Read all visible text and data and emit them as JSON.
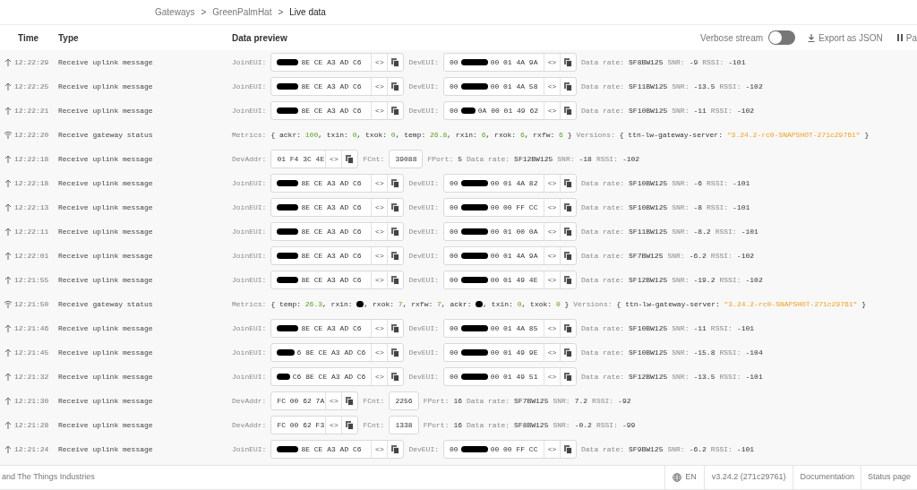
{
  "breadcrumb": [
    {
      "label": "Gateways",
      "current": false
    },
    {
      "label": "GreenPalmHat",
      "current": false
    },
    {
      "label": "Live data",
      "current": true
    }
  ],
  "breadcrumb_separators": [
    ">",
    ">"
  ],
  "columns": [
    "Time",
    "Type",
    "Data preview"
  ],
  "toolbar": {
    "verbose_label": "Verbose stream",
    "verbose_on": false,
    "export_label": "Export as JSON",
    "pause_label": "Pa"
  },
  "rows": [
    {
      "kind": "uplink",
      "time": "12:22:29",
      "type": "Receive uplink message",
      "parts": [
        {
          "kind": "label",
          "text": "JoinEUI:"
        },
        {
          "kind": "box",
          "segments": [
            {
              "redacted": true
            },
            {
              "text": "8E CE A3 AD C6"
            }
          ],
          "code": "<>"
        },
        {
          "kind": "label",
          "text": "DevEUI:"
        },
        {
          "kind": "box",
          "segments": [
            {
              "text": "00"
            },
            {
              "redacted": true
            },
            {
              "text": "00 01 4A 9A"
            }
          ],
          "code": "<>"
        },
        {
          "kind": "label",
          "text": "Data rate:"
        },
        {
          "kind": "value",
          "text": "SF8BW125"
        },
        {
          "kind": "label",
          "text": "SNR:"
        },
        {
          "kind": "value",
          "text": "-9"
        },
        {
          "kind": "label",
          "text": "RSSI:"
        },
        {
          "kind": "value",
          "text": "-101"
        }
      ]
    },
    {
      "kind": "uplink",
      "time": "12:22:25",
      "type": "Receive uplink message",
      "parts": [
        {
          "kind": "label",
          "text": "JoinEUI:"
        },
        {
          "kind": "box",
          "segments": [
            {
              "redacted": true
            },
            {
              "text": "8E CE A3 AD C6"
            }
          ],
          "code": "<>"
        },
        {
          "kind": "label",
          "text": "DevEUI:"
        },
        {
          "kind": "box",
          "segments": [
            {
              "text": "00"
            },
            {
              "redacted": true
            },
            {
              "text": "00 01 4A 58"
            }
          ],
          "code": "<>"
        },
        {
          "kind": "label",
          "text": "Data rate:"
        },
        {
          "kind": "value",
          "text": "SF11BW125"
        },
        {
          "kind": "label",
          "text": "SNR:"
        },
        {
          "kind": "value",
          "text": "-13.5"
        },
        {
          "kind": "label",
          "text": "RSSI:"
        },
        {
          "kind": "value",
          "text": "-102"
        }
      ]
    },
    {
      "kind": "uplink",
      "time": "12:22:21",
      "type": "Receive uplink message",
      "parts": [
        {
          "kind": "label",
          "text": "JoinEUI:"
        },
        {
          "kind": "box",
          "segments": [
            {
              "redacted": true
            },
            {
              "text": "8E CE A3 AD C6"
            }
          ],
          "code": "<>"
        },
        {
          "kind": "label",
          "text": "DevEUI:"
        },
        {
          "kind": "box",
          "segments": [
            {
              "text": "00"
            },
            {
              "redacted": true
            },
            {
              "text": "0A 00 01 49 62"
            }
          ],
          "code": "<>"
        },
        {
          "kind": "label",
          "text": "Data rate:"
        },
        {
          "kind": "value",
          "text": "SF10BW125"
        },
        {
          "kind": "label",
          "text": "SNR:"
        },
        {
          "kind": "value",
          "text": "-11"
        },
        {
          "kind": "label",
          "text": "RSSI:"
        },
        {
          "kind": "value",
          "text": "-102"
        }
      ]
    },
    {
      "kind": "gateway",
      "time": "12:22:20",
      "type": "Receive gateway status",
      "parts": [
        {
          "kind": "label",
          "text": "Metrics:"
        },
        {
          "kind": "code",
          "tokens": [
            {
              "text": "{ ackr: "
            },
            {
              "text": "100",
              "kind": "number"
            },
            {
              "text": ", txin: "
            },
            {
              "text": "0",
              "kind": "number"
            },
            {
              "text": ", txok: "
            },
            {
              "text": "0",
              "kind": "number"
            },
            {
              "text": ", temp: "
            },
            {
              "text": "26.8",
              "kind": "number"
            },
            {
              "text": ", rxin: "
            },
            {
              "text": "6",
              "kind": "number"
            },
            {
              "text": ", rxok: "
            },
            {
              "text": "6",
              "kind": "number"
            },
            {
              "text": ", rxfw: "
            },
            {
              "text": "6",
              "kind": "number"
            },
            {
              "text": " }"
            }
          ]
        },
        {
          "kind": "label",
          "text": "Versions:"
        },
        {
          "kind": "code",
          "tokens": [
            {
              "text": "{ ttn-lw-gateway-server: "
            },
            {
              "text": "\"3.24.2-rc0-SNAPSHOT-271c29761\"",
              "kind": "string"
            },
            {
              "text": " }"
            }
          ]
        }
      ]
    },
    {
      "kind": "uplink",
      "time": "12:22:18",
      "type": "Receive uplink message",
      "parts": [
        {
          "kind": "label",
          "text": "DevAddr:"
        },
        {
          "kind": "box",
          "segments": [
            {
              "text": "01 F4 3C 4E"
            }
          ],
          "code": "<>"
        },
        {
          "kind": "label",
          "text": "FCnt:"
        },
        {
          "kind": "plain_box",
          "text": "39088"
        },
        {
          "kind": "label",
          "text": "FPort:"
        },
        {
          "kind": "value",
          "text": "5"
        },
        {
          "kind": "label",
          "text": "Data rate:"
        },
        {
          "kind": "value",
          "text": "SF12BW125"
        },
        {
          "kind": "label",
          "text": "SNR:"
        },
        {
          "kind": "value",
          "text": "-18"
        },
        {
          "kind": "label",
          "text": "RSSI:"
        },
        {
          "kind": "value",
          "text": "-102"
        }
      ]
    },
    {
      "kind": "uplink",
      "time": "12:22:18",
      "type": "Receive uplink message",
      "parts": [
        {
          "kind": "label",
          "text": "JoinEUI:"
        },
        {
          "kind": "box",
          "segments": [
            {
              "redacted": true
            },
            {
              "text": "8E CE A3 AD C6"
            }
          ],
          "code": "<>"
        },
        {
          "kind": "label",
          "text": "DevEUI:"
        },
        {
          "kind": "box",
          "segments": [
            {
              "text": "00"
            },
            {
              "redacted": true
            },
            {
              "text": "00 01 4A 82"
            }
          ],
          "code": "<>"
        },
        {
          "kind": "label",
          "text": "Data rate:"
        },
        {
          "kind": "value",
          "text": "SF10BW125"
        },
        {
          "kind": "label",
          "text": "SNR:"
        },
        {
          "kind": "value",
          "text": "-6"
        },
        {
          "kind": "label",
          "text": "RSSI:"
        },
        {
          "kind": "value",
          "text": "-101"
        }
      ]
    },
    {
      "kind": "uplink",
      "time": "12:22:13",
      "type": "Receive uplink message",
      "parts": [
        {
          "kind": "label",
          "text": "JoinEUI:"
        },
        {
          "kind": "box",
          "segments": [
            {
              "redacted": true
            },
            {
              "text": "8E CE A3 AD C6"
            }
          ],
          "code": "<>"
        },
        {
          "kind": "label",
          "text": "DevEUI:"
        },
        {
          "kind": "box",
          "segments": [
            {
              "text": "00"
            },
            {
              "redacted": true
            },
            {
              "text": "00 00 FF CC"
            }
          ],
          "code": "<>"
        },
        {
          "kind": "label",
          "text": "Data rate:"
        },
        {
          "kind": "value",
          "text": "SF10BW125"
        },
        {
          "kind": "label",
          "text": "SNR:"
        },
        {
          "kind": "value",
          "text": "-8"
        },
        {
          "kind": "label",
          "text": "RSSI:"
        },
        {
          "kind": "value",
          "text": "-101"
        }
      ]
    },
    {
      "kind": "uplink",
      "time": "12:22:11",
      "type": "Receive uplink message",
      "parts": [
        {
          "kind": "label",
          "text": "JoinEUI:"
        },
        {
          "kind": "box",
          "segments": [
            {
              "redacted": true
            },
            {
              "text": "8E CE A3 AD C6"
            }
          ],
          "code": "<>"
        },
        {
          "kind": "label",
          "text": "DevEUI:"
        },
        {
          "kind": "box",
          "segments": [
            {
              "text": "00"
            },
            {
              "redacted": true
            },
            {
              "text": "00 01 00 0A"
            }
          ],
          "code": "<>"
        },
        {
          "kind": "label",
          "text": "Data rate:"
        },
        {
          "kind": "value",
          "text": "SF11BW125"
        },
        {
          "kind": "label",
          "text": "SNR:"
        },
        {
          "kind": "value",
          "text": "-8.2"
        },
        {
          "kind": "label",
          "text": "RSSI:"
        },
        {
          "kind": "value",
          "text": "-101"
        }
      ]
    },
    {
      "kind": "uplink",
      "time": "12:22:01",
      "type": "Receive uplink message",
      "parts": [
        {
          "kind": "label",
          "text": "JoinEUI:"
        },
        {
          "kind": "box",
          "segments": [
            {
              "redacted": true
            },
            {
              "text": "8E CE A3 AD C6"
            }
          ],
          "code": "<>"
        },
        {
          "kind": "label",
          "text": "DevEUI:"
        },
        {
          "kind": "box",
          "segments": [
            {
              "text": "00"
            },
            {
              "redacted": true
            },
            {
              "text": "00 01 4A 9A"
            }
          ],
          "code": "<>"
        },
        {
          "kind": "label",
          "text": "Data rate:"
        },
        {
          "kind": "value",
          "text": "SF7BW125"
        },
        {
          "kind": "label",
          "text": "SNR:"
        },
        {
          "kind": "value",
          "text": "-6.2"
        },
        {
          "kind": "label",
          "text": "RSSI:"
        },
        {
          "kind": "value",
          "text": "-102"
        }
      ]
    },
    {
      "kind": "uplink",
      "time": "12:21:55",
      "type": "Receive uplink message",
      "parts": [
        {
          "kind": "label",
          "text": "JoinEUI:"
        },
        {
          "kind": "box",
          "segments": [
            {
              "redacted": true
            },
            {
              "text": "8E CE A3 AD C6"
            }
          ],
          "code": "<>"
        },
        {
          "kind": "label",
          "text": "DevEUI:"
        },
        {
          "kind": "box",
          "segments": [
            {
              "text": "00"
            },
            {
              "redacted": true
            },
            {
              "text": "00 01 49 4E"
            }
          ],
          "code": "<>"
        },
        {
          "kind": "label",
          "text": "Data rate:"
        },
        {
          "kind": "value",
          "text": "SF12BW125"
        },
        {
          "kind": "label",
          "text": "SNR:"
        },
        {
          "kind": "value",
          "text": "-19.2"
        },
        {
          "kind": "label",
          "text": "RSSI:"
        },
        {
          "kind": "value",
          "text": "-102"
        }
      ]
    },
    {
      "kind": "gateway",
      "time": "12:21:50",
      "type": "Receive gateway status",
      "parts": [
        {
          "kind": "label",
          "text": "Metrics:"
        },
        {
          "kind": "code",
          "tokens": [
            {
              "text": "{ temp: "
            },
            {
              "text": "26.3",
              "kind": "number"
            },
            {
              "text": ", rxin: "
            },
            {
              "kind": "redacted"
            },
            {
              "text": ", rxok: "
            },
            {
              "text": "7",
              "kind": "number"
            },
            {
              "text": ", rxfw: "
            },
            {
              "text": "7",
              "kind": "number"
            },
            {
              "text": ", ackr: "
            },
            {
              "kind": "redacted"
            },
            {
              "text": ", txin: "
            },
            {
              "text": "0",
              "kind": "number"
            },
            {
              "text": ", txok: "
            },
            {
              "text": "0",
              "kind": "number"
            },
            {
              "text": " }"
            }
          ]
        },
        {
          "kind": "label",
          "text": "Versions:"
        },
        {
          "kind": "code",
          "tokens": [
            {
              "text": "{ ttn-lw-gateway-server: "
            },
            {
              "text": "\"3.24.2-rc0-SNAPSHOT-271c29761\"",
              "kind": "string"
            },
            {
              "text": " }"
            }
          ]
        }
      ]
    },
    {
      "kind": "uplink",
      "time": "12:21:46",
      "type": "Receive uplink message",
      "parts": [
        {
          "kind": "label",
          "text": "JoinEUI:"
        },
        {
          "kind": "box",
          "segments": [
            {
              "redacted": true
            },
            {
              "text": "8E CE A3 AD C6"
            }
          ],
          "code": "<>"
        },
        {
          "kind": "label",
          "text": "DevEUI:"
        },
        {
          "kind": "box",
          "segments": [
            {
              "text": "00"
            },
            {
              "redacted": true
            },
            {
              "text": "00 01 4A 85"
            }
          ],
          "code": "<>"
        },
        {
          "kind": "label",
          "text": "Data rate:"
        },
        {
          "kind": "value",
          "text": "SF10BW125"
        },
        {
          "kind": "label",
          "text": "SNR:"
        },
        {
          "kind": "value",
          "text": "-11"
        },
        {
          "kind": "label",
          "text": "RSSI:"
        },
        {
          "kind": "value",
          "text": "-101"
        }
      ]
    },
    {
      "kind": "uplink",
      "time": "12:21:45",
      "type": "Receive uplink message",
      "parts": [
        {
          "kind": "label",
          "text": "JoinEUI:"
        },
        {
          "kind": "box",
          "segments": [
            {
              "redacted": true
            },
            {
              "text": "6 8E CE A3 AD C6"
            }
          ],
          "code": "<>"
        },
        {
          "kind": "label",
          "text": "DevEUI:"
        },
        {
          "kind": "box",
          "segments": [
            {
              "text": "00"
            },
            {
              "redacted": true
            },
            {
              "text": "00 01 49 9E"
            }
          ],
          "code": "<>"
        },
        {
          "kind": "label",
          "text": "Data rate:"
        },
        {
          "kind": "value",
          "text": "SF10BW125"
        },
        {
          "kind": "label",
          "text": "SNR:"
        },
        {
          "kind": "value",
          "text": "-15.8"
        },
        {
          "kind": "label",
          "text": "RSSI:"
        },
        {
          "kind": "value",
          "text": "-104"
        }
      ]
    },
    {
      "kind": "uplink",
      "time": "12:21:32",
      "type": "Receive uplink message",
      "parts": [
        {
          "kind": "label",
          "text": "JoinEUI:"
        },
        {
          "kind": "box",
          "segments": [
            {
              "redacted": true
            },
            {
              "text": "C6 8E CE A3 AD C6"
            }
          ],
          "code": "<>"
        },
        {
          "kind": "label",
          "text": "DevEUI:"
        },
        {
          "kind": "box",
          "segments": [
            {
              "text": "00"
            },
            {
              "redacted": true
            },
            {
              "text": "00 01 49 51"
            }
          ],
          "code": "<>"
        },
        {
          "kind": "label",
          "text": "Data rate:"
        },
        {
          "kind": "value",
          "text": "SF12BW125"
        },
        {
          "kind": "label",
          "text": "SNR:"
        },
        {
          "kind": "value",
          "text": "-13.5"
        },
        {
          "kind": "label",
          "text": "RSSI:"
        },
        {
          "kind": "value",
          "text": "-101"
        }
      ]
    },
    {
      "kind": "uplink",
      "time": "12:21:30",
      "type": "Receive uplink message",
      "parts": [
        {
          "kind": "label",
          "text": "DevAddr:"
        },
        {
          "kind": "box",
          "segments": [
            {
              "text": "FC 00 62 7A"
            }
          ],
          "code": "<>"
        },
        {
          "kind": "label",
          "text": "FCnt:"
        },
        {
          "kind": "plain_box",
          "text": "2256"
        },
        {
          "kind": "label",
          "text": "FPort:"
        },
        {
          "kind": "value",
          "text": "16"
        },
        {
          "kind": "label",
          "text": "Data rate:"
        },
        {
          "kind": "value",
          "text": "SF7BW125"
        },
        {
          "kind": "label",
          "text": "SNR:"
        },
        {
          "kind": "value",
          "text": "7.2"
        },
        {
          "kind": "label",
          "text": "RSSI:"
        },
        {
          "kind": "value",
          "text": "-92"
        }
      ]
    },
    {
      "kind": "uplink",
      "time": "12:21:28",
      "type": "Receive uplink message",
      "parts": [
        {
          "kind": "label",
          "text": "DevAddr:"
        },
        {
          "kind": "box",
          "segments": [
            {
              "text": "FC 00 62 F3"
            }
          ],
          "code": "<>"
        },
        {
          "kind": "label",
          "text": "FCnt:"
        },
        {
          "kind": "plain_box",
          "text": "1338"
        },
        {
          "kind": "label",
          "text": "FPort:"
        },
        {
          "kind": "value",
          "text": "16"
        },
        {
          "kind": "label",
          "text": "Data rate:"
        },
        {
          "kind": "value",
          "text": "SF8BW125"
        },
        {
          "kind": "label",
          "text": "SNR:"
        },
        {
          "kind": "value",
          "text": "-0.2"
        },
        {
          "kind": "label",
          "text": "RSSI:"
        },
        {
          "kind": "value",
          "text": "-99"
        }
      ]
    },
    {
      "kind": "uplink",
      "time": "12:21:24",
      "type": "Receive uplink message",
      "parts": [
        {
          "kind": "label",
          "text": "JoinEUI:"
        },
        {
          "kind": "box",
          "segments": [
            {
              "redacted": true
            },
            {
              "text": "8E CE A3 AD C6"
            }
          ],
          "code": "<>"
        },
        {
          "kind": "label",
          "text": "DevEUI:"
        },
        {
          "kind": "box",
          "segments": [
            {
              "text": "00"
            },
            {
              "redacted": true
            },
            {
              "text": "00 00 FF CC"
            }
          ],
          "code": "<>"
        },
        {
          "kind": "label",
          "text": "Data rate:"
        },
        {
          "kind": "value",
          "text": "SF9BW125"
        },
        {
          "kind": "label",
          "text": "SNR:"
        },
        {
          "kind": "value",
          "text": "-6.2"
        },
        {
          "kind": "label",
          "text": "RSSI:"
        },
        {
          "kind": "value",
          "text": "-101"
        }
      ]
    }
  ],
  "footer": {
    "credit": "and The Things Industries",
    "language": "EN",
    "version": "v3.24.2 (271c29761)",
    "links": [
      "Documentation",
      "Status page"
    ]
  }
}
